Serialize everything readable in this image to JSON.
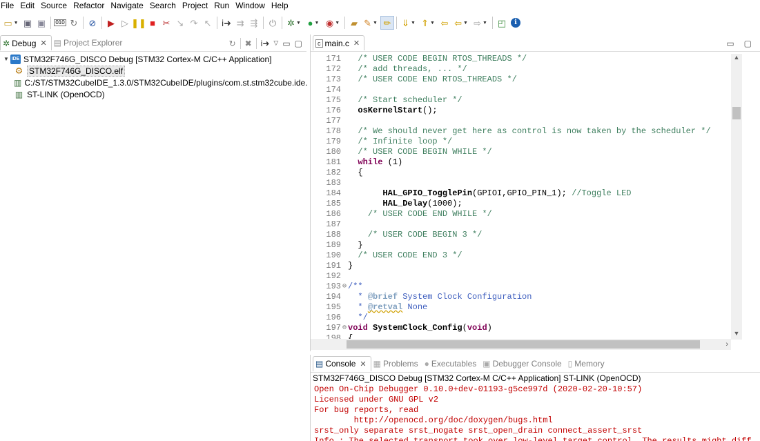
{
  "menu": [
    "File",
    "Edit",
    "Source",
    "Refactor",
    "Navigate",
    "Search",
    "Project",
    "Run",
    "Window",
    "Help"
  ],
  "colors": {
    "comment": "#3f7f5f",
    "keyword": "#7f0055",
    "doc": "#3f5fbf",
    "console_text": "#c20000",
    "ide_badge": "#2a78c8"
  },
  "left_panel": {
    "tabs": [
      {
        "label": "Debug",
        "icon": "debug-bug-icon",
        "active": true
      },
      {
        "label": "Project Explorer",
        "icon": "project-explorer-icon",
        "active": false
      }
    ],
    "tree": [
      {
        "label": "STM32F746G_DISCO Debug [STM32 Cortex-M C/C++ Application]",
        "icon": "ide-launch-icon",
        "badge": "IDE",
        "level": 0,
        "expanded": true
      },
      {
        "label": "STM32F746G_DISCO.elf",
        "icon": "elf-binary-icon",
        "level": 1,
        "selected": true
      },
      {
        "label": "C:/ST/STM32CubeIDE_1.3.0/STM32CubeIDE/plugins/com.st.stm32cube.ide.",
        "icon": "process-icon",
        "level": 1
      },
      {
        "label": "ST-LINK (OpenOCD)",
        "icon": "process-icon",
        "level": 1
      }
    ]
  },
  "editor": {
    "tab_label": "main.c",
    "lines": [
      {
        "n": "171",
        "fold": "",
        "parts": [
          [
            "",
            "  "
          ],
          [
            "cm",
            "/* USER CODE BEGIN RTOS_THREADS */"
          ]
        ]
      },
      {
        "n": "172",
        "fold": "",
        "parts": [
          [
            "",
            "  "
          ],
          [
            "cm",
            "/* add threads, ... */"
          ]
        ]
      },
      {
        "n": "173",
        "fold": "",
        "parts": [
          [
            "",
            "  "
          ],
          [
            "cm",
            "/* USER CODE END RTOS_THREADS */"
          ]
        ]
      },
      {
        "n": "174",
        "fold": "",
        "parts": []
      },
      {
        "n": "175",
        "fold": "",
        "parts": [
          [
            "",
            "  "
          ],
          [
            "cm",
            "/* Start scheduler */"
          ]
        ]
      },
      {
        "n": "176",
        "fold": "",
        "parts": [
          [
            "",
            "  "
          ],
          [
            "fn",
            "osKernelStart"
          ],
          [
            "",
            "();"
          ]
        ]
      },
      {
        "n": "177",
        "fold": "",
        "parts": []
      },
      {
        "n": "178",
        "fold": "",
        "parts": [
          [
            "",
            "  "
          ],
          [
            "cm",
            "/* We should never get here as control is now taken by the scheduler */"
          ]
        ]
      },
      {
        "n": "179",
        "fold": "",
        "parts": [
          [
            "",
            "  "
          ],
          [
            "cm",
            "/* Infinite loop */"
          ]
        ]
      },
      {
        "n": "180",
        "fold": "",
        "parts": [
          [
            "",
            "  "
          ],
          [
            "cm",
            "/* USER CODE BEGIN WHILE */"
          ]
        ]
      },
      {
        "n": "181",
        "fold": "",
        "parts": [
          [
            "",
            "  "
          ],
          [
            "kw",
            "while"
          ],
          [
            "",
            " (1)"
          ]
        ]
      },
      {
        "n": "182",
        "fold": "",
        "parts": [
          [
            "",
            "  {"
          ]
        ]
      },
      {
        "n": "183",
        "fold": "",
        "parts": []
      },
      {
        "n": "184",
        "fold": "",
        "parts": [
          [
            "",
            "       "
          ],
          [
            "fn",
            "HAL_GPIO_TogglePin"
          ],
          [
            "",
            "(GPIOI,GPIO_PIN_1); "
          ],
          [
            "cm",
            "//Toggle LED"
          ]
        ]
      },
      {
        "n": "185",
        "fold": "",
        "parts": [
          [
            "",
            "       "
          ],
          [
            "fn",
            "HAL_Delay"
          ],
          [
            "",
            "(1000);"
          ]
        ]
      },
      {
        "n": "186",
        "fold": "",
        "parts": [
          [
            "",
            "    "
          ],
          [
            "cm",
            "/* USER CODE END WHILE */"
          ]
        ]
      },
      {
        "n": "187",
        "fold": "",
        "parts": []
      },
      {
        "n": "188",
        "fold": "",
        "parts": [
          [
            "",
            "    "
          ],
          [
            "cm",
            "/* USER CODE BEGIN 3 */"
          ]
        ]
      },
      {
        "n": "189",
        "fold": "",
        "parts": [
          [
            "",
            "  }"
          ]
        ]
      },
      {
        "n": "190",
        "fold": "",
        "parts": [
          [
            "",
            "  "
          ],
          [
            "cm",
            "/* USER CODE END 3 */"
          ]
        ]
      },
      {
        "n": "191",
        "fold": "",
        "parts": [
          [
            "",
            "}"
          ]
        ]
      },
      {
        "n": "192",
        "fold": "",
        "parts": []
      },
      {
        "n": "193",
        "fold": "⊖",
        "parts": [
          [
            "doc",
            "/**"
          ]
        ]
      },
      {
        "n": "194",
        "fold": "",
        "parts": [
          [
            "doc",
            "  * "
          ],
          [
            "doc-tag",
            "@brief"
          ],
          [
            "doc",
            " System Clock Configuration"
          ]
        ]
      },
      {
        "n": "195",
        "fold": "",
        "parts": [
          [
            "doc",
            "  * "
          ],
          [
            "doc-tag squig",
            "@retval"
          ],
          [
            "doc",
            " None"
          ]
        ]
      },
      {
        "n": "196",
        "fold": "",
        "parts": [
          [
            "doc",
            "  */"
          ]
        ]
      },
      {
        "n": "197",
        "fold": "⊖",
        "parts": [
          [
            "kw",
            "void"
          ],
          [
            "",
            " "
          ],
          [
            "fn",
            "SystemClock_Config"
          ],
          [
            "",
            "("
          ],
          [
            "kw",
            "void"
          ],
          [
            "",
            ")"
          ]
        ]
      },
      {
        "n": "198",
        "fold": "",
        "parts": [
          [
            "",
            "{"
          ]
        ]
      }
    ]
  },
  "console": {
    "tabs": [
      {
        "label": "Console",
        "icon": "console-icon",
        "active": true
      },
      {
        "label": "Problems",
        "icon": "problems-icon",
        "active": false
      },
      {
        "label": "Executables",
        "icon": "executables-icon",
        "active": false
      },
      {
        "label": "Debugger Console",
        "icon": "debugger-console-icon",
        "active": false
      },
      {
        "label": "Memory",
        "icon": "memory-icon",
        "active": false
      }
    ],
    "title": "STM32F746G_DISCO Debug [STM32 Cortex-M C/C++ Application] ST-LINK (OpenOCD)",
    "output": [
      "Open On-Chip Debugger 0.10.0+dev-01193-g5ce997d (2020-02-20-10:57)",
      "Licensed under GNU GPL v2",
      "For bug reports, read",
      "        http://openocd.org/doc/doxygen/bugs.html",
      "srst_only separate srst_nogate srst_open_drain connect_assert_srst",
      "Info : The selected transport took over low-level target control. The results might diff"
    ]
  }
}
